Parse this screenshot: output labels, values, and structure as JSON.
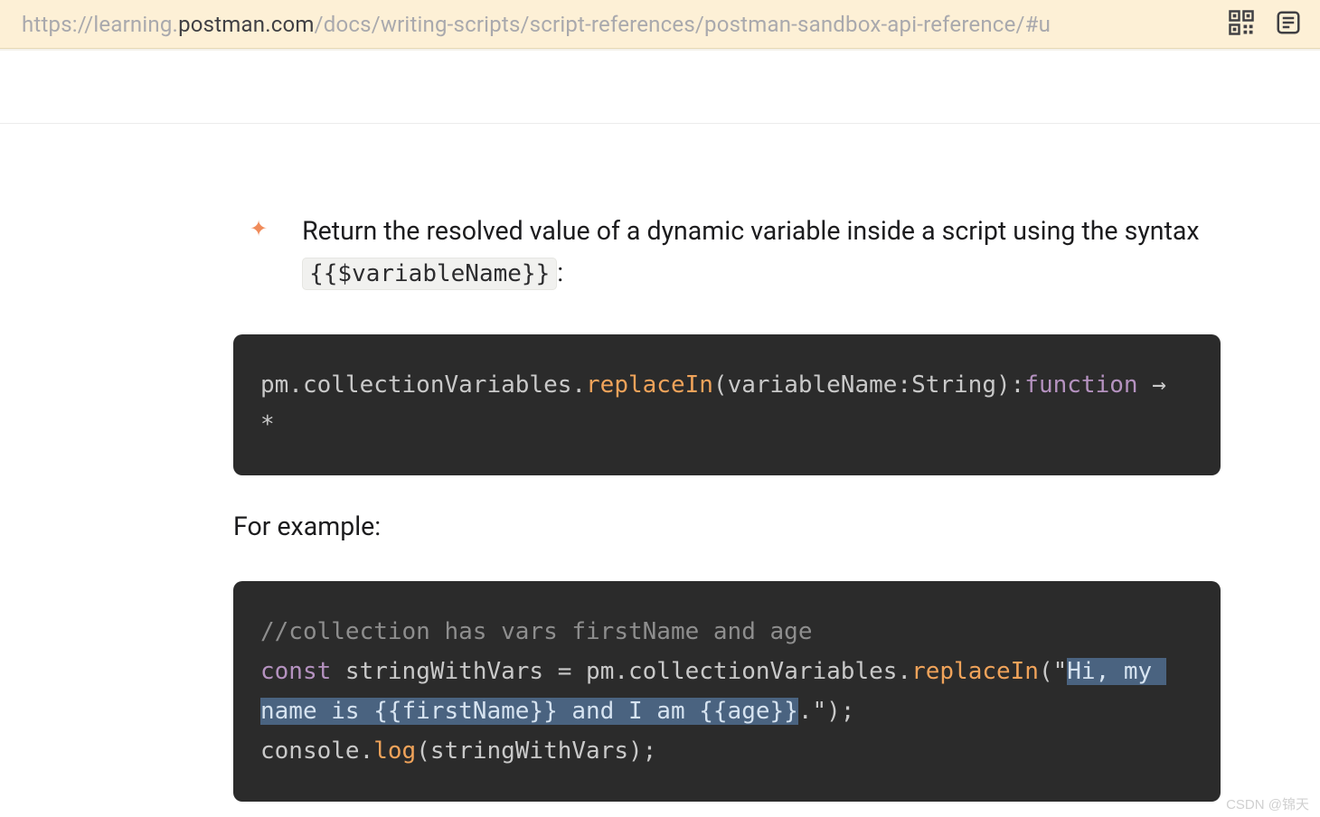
{
  "url": {
    "p1": "https://learning.",
    "p2": "postman.com",
    "p3": "/docs/writing-scripts/script-references/postman-sandbox-api-reference/",
    "p4": "#u"
  },
  "bullet": {
    "text_before": "Return the resolved value of a dynamic variable inside a script using the syntax ",
    "code": "{{$variableName}}",
    "text_after": ":"
  },
  "code1": {
    "s1": "pm.collectionVariables.",
    "s2": "replaceIn",
    "s3": "(variableName:String):",
    "s4": "function",
    "s5": " → *"
  },
  "for_example": "For example:",
  "code2": {
    "l1": "//collection has vars firstName and age",
    "l2a": "const",
    "l2b": " stringWithVars = pm.collectionVariables.",
    "l2c": "replaceIn",
    "l2d": "(\"",
    "l2e": "Hi, my name is {{firstName}} and I am {{age}}",
    "l2f": ".\");",
    "l3a": "console.",
    "l3b": "log",
    "l3c": "(stringWithVars);"
  },
  "watermark": "CSDN @锦天"
}
